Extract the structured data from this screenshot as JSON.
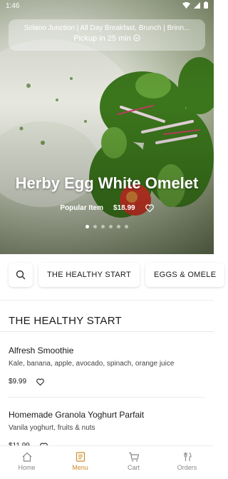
{
  "status": {
    "time": "1:46"
  },
  "store": {
    "name": "Solano Junction | All Day Breakfast, Brunch | Brinn...",
    "pickup": "Pickup in 25 min"
  },
  "featured": {
    "title": "Herby Egg White Omelet",
    "badge": "Popular Item",
    "price": "$18.99",
    "slides_total": 6,
    "active_slide": 1
  },
  "categories": [
    "THE HEALTHY START",
    "EGGS & OMELE"
  ],
  "section": {
    "title": "THE HEALTHY START",
    "items": [
      {
        "name": "Alfresh Smoothie",
        "description": "Kale, banana, apple, avocado, spinach, orange juice",
        "price": "$9.99"
      },
      {
        "name": "Homemade Granola Yoghurt Parfait",
        "description": "Vanila yoghurt, fruits & nuts",
        "price": "$11.99"
      }
    ]
  },
  "tabs": [
    {
      "label": "Home",
      "icon": "home-icon"
    },
    {
      "label": "Menu",
      "icon": "menu-icon"
    },
    {
      "label": "Cart",
      "icon": "cart-icon"
    },
    {
      "label": "Orders",
      "icon": "orders-icon"
    }
  ],
  "colors": {
    "accent": "#d08a2c",
    "inactive": "#888888"
  }
}
